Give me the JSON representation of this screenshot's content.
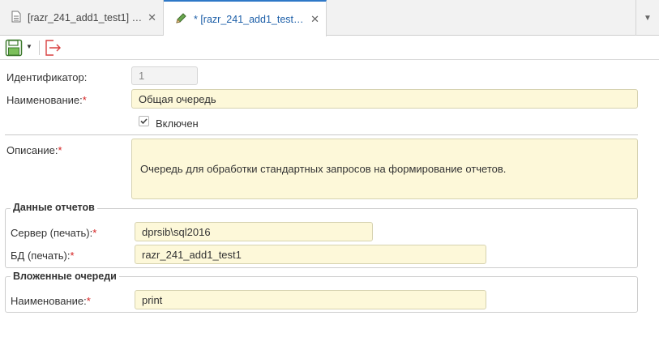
{
  "tabs": [
    {
      "label": "[razr_241_add1_test1] Се…",
      "icon": "document-icon",
      "active": false
    },
    {
      "label": "* [razr_241_add1_test1] С…",
      "icon": "pencil-icon",
      "active": true
    }
  ],
  "form": {
    "identifier": {
      "label": "Идентификатор:",
      "value": "1"
    },
    "name": {
      "label": "Наименование:",
      "required_mark": "*",
      "value": "Общая очередь"
    },
    "enabled": {
      "label": "Включен",
      "checked": true
    },
    "description": {
      "label": "Описание:",
      "required_mark": "*",
      "value": "Очередь для обработки стандартных запросов на формирование отчетов."
    }
  },
  "report_data": {
    "title": "Данные отчетов",
    "server": {
      "label": "Сервер (печать):",
      "required_mark": "*",
      "value": "dprsib\\sql2016"
    },
    "database": {
      "label": "БД (печать):",
      "required_mark": "*",
      "value": "razr_241_add1_test1"
    }
  },
  "nested_queues": {
    "title": "Вложенные очереди",
    "name": {
      "label": "Наименование:",
      "required_mark": "*",
      "value": "print"
    }
  },
  "colors": {
    "accent": "#2e78c7",
    "required": "#d42020",
    "field_bg": "#fdf8d9"
  }
}
